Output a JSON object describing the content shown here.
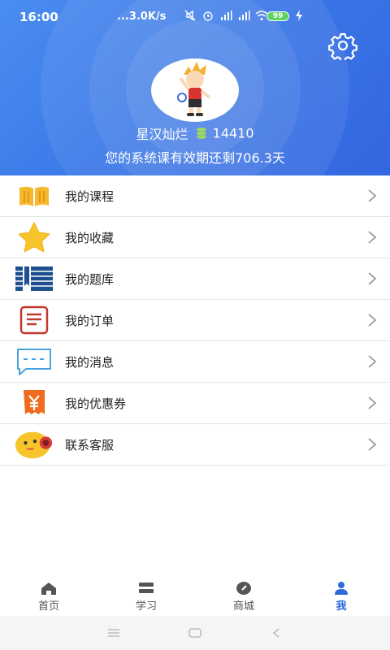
{
  "status_bar": {
    "time": "16:00",
    "network_speed": "...3.0K/s",
    "battery": "99"
  },
  "profile": {
    "username": "星汉灿烂",
    "coins": "14410",
    "validity_text": "您的系统课有效期还剩706.3天"
  },
  "menu": {
    "items": [
      {
        "label": "我的课程",
        "icon": "book-icon"
      },
      {
        "label": "我的收藏",
        "icon": "star-icon"
      },
      {
        "label": "我的题库",
        "icon": "question-bank-icon"
      },
      {
        "label": "我的订单",
        "icon": "order-icon"
      },
      {
        "label": "我的消息",
        "icon": "message-icon"
      },
      {
        "label": "我的优惠券",
        "icon": "coupon-icon"
      },
      {
        "label": "联系客服",
        "icon": "customer-service-icon"
      }
    ]
  },
  "bottom_nav": {
    "tabs": [
      {
        "label": "首页",
        "icon": "home-icon",
        "active": false
      },
      {
        "label": "学习",
        "icon": "study-icon",
        "active": false
      },
      {
        "label": "商城",
        "icon": "mall-icon",
        "active": false
      },
      {
        "label": "我",
        "icon": "profile-icon",
        "active": true
      }
    ]
  },
  "colors": {
    "header_start": "#4a8df0",
    "header_end": "#3366e0",
    "active_tab": "#2a6bd8",
    "text": "#222222"
  }
}
